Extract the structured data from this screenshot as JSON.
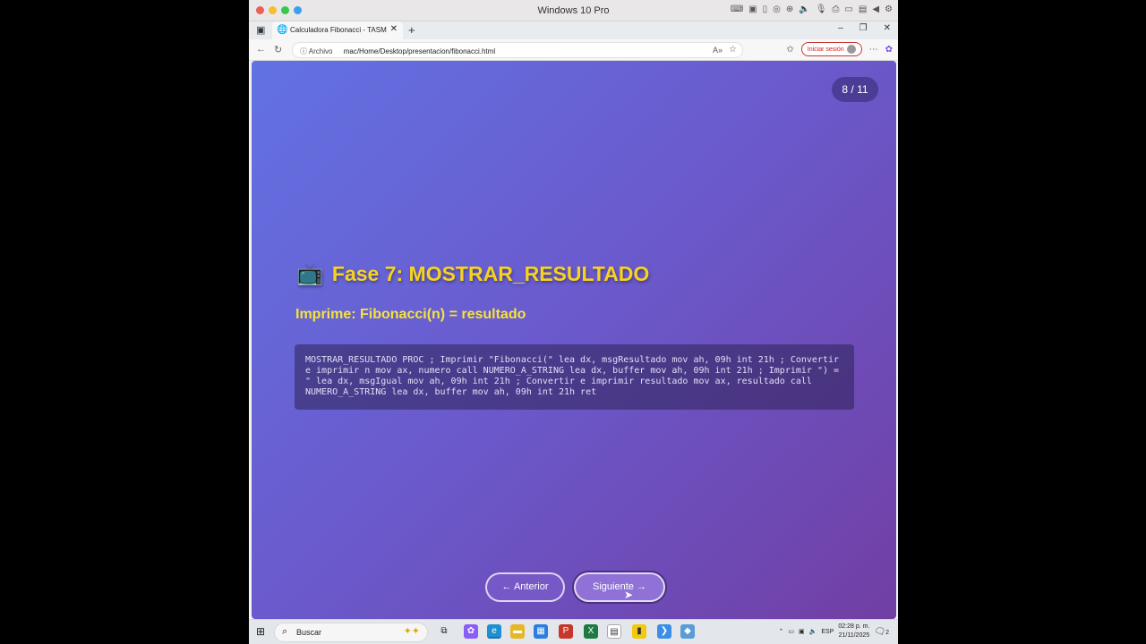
{
  "vm_window": {
    "title": "Windows 10 Pro"
  },
  "browser": {
    "tab_title": "Calculadora Fibonacci - TASM",
    "url_info": "Archivo",
    "url": "mac/Home/Desktop/presentacion/fibonacci.html",
    "login_label": "Iniciar sesión"
  },
  "slide": {
    "counter": "8 / 11",
    "title_icon": "📺",
    "title": "Fase 7: MOSTRAR_RESULTADO",
    "subtitle": "Imprime: Fibonacci(n) = resultado",
    "code": "MOSTRAR_RESULTADO PROC ; Imprimir \"Fibonacci(\" lea dx, msgResultado mov ah, 09h int 21h ; Convertir e imprimir n mov ax, numero call NUMERO_A_STRING lea dx, buffer mov ah, 09h int 21h ; Imprimir \") = \" lea dx, msgIgual mov ah, 09h int 21h ; Convertir e imprimir resultado mov ax, resultado call NUMERO_A_STRING lea dx, buffer mov ah, 09h int 21h ret",
    "prev_label": "← Anterior",
    "next_label": "Siguiente →"
  },
  "taskbar": {
    "search_placeholder": "Buscar",
    "lang": "ESP",
    "time": "02:28 p. m.",
    "date": "21/11/2025",
    "notifications": "2"
  },
  "colors": {
    "title_yellow": "#f6d31e",
    "slide_start": "#6272e2",
    "slide_end": "#713fa4"
  }
}
